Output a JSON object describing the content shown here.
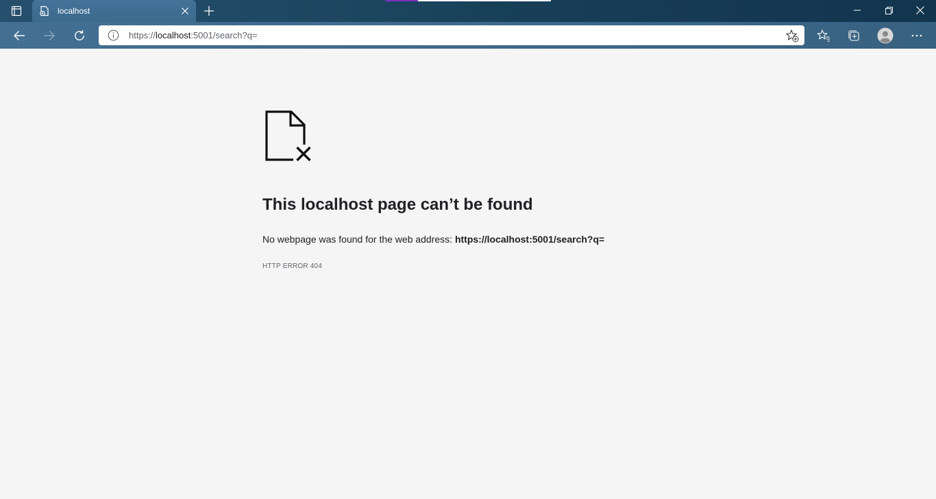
{
  "browser": {
    "tab": {
      "title": "localhost"
    },
    "address": {
      "scheme_prefix": "https://",
      "host": "localhost",
      "rest": ":5001/search?q="
    },
    "colors": {
      "titlebar": "#1c4560",
      "toolbar": "#3c6a8c",
      "accent_purple": "#7b2fbf",
      "accent_white": "#ffffff"
    },
    "icons": {
      "tab_actions": "tab-actions-icon",
      "favicon": "page-error-favicon",
      "tab_close": "close-icon",
      "new_tab": "plus-icon",
      "back": "back-arrow-icon",
      "forward": "forward-arrow-icon",
      "refresh": "refresh-icon",
      "site_info": "info-icon",
      "add_favorite": "star-add-icon",
      "favorites": "favorites-icon",
      "collections": "collections-icon",
      "profile": "profile-avatar-icon",
      "menu": "more-icon",
      "minimize": "minimize-icon",
      "restore": "restore-icon",
      "close": "close-icon"
    }
  },
  "page": {
    "title": "This localhost page can’t be found",
    "description_prefix": "No webpage was found for the web address:",
    "description_url": "https://localhost:5001/search?q=",
    "error_code": "HTTP ERROR 404"
  }
}
